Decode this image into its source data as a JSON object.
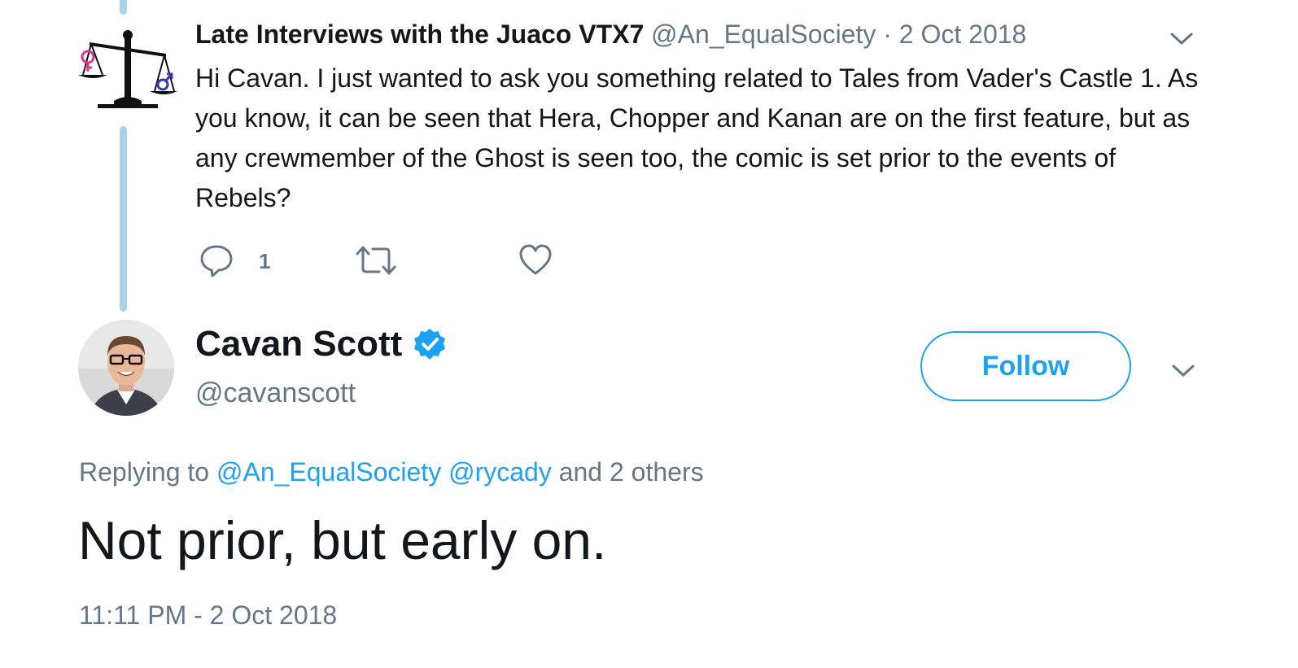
{
  "parent_tweet": {
    "display_name": "Late Interviews with the Juaco VTX7",
    "handle": "@An_EqualSociety",
    "separator": "·",
    "date": "2 Oct 2018",
    "text": "Hi Cavan. I just wanted to ask you something related to Tales from Vader's Castle 1. As you know, it can be seen that Hera, Chopper and Kanan are on the first feature, but as any crewmember of the Ghost is seen too, the comic is set prior to the events of Rebels?",
    "reply_count": "1"
  },
  "main_tweet": {
    "display_name": "Cavan Scott",
    "handle": "@cavanscott",
    "follow_label": "Follow",
    "replying_prefix": "Replying to",
    "mentions": [
      "@An_EqualSociety",
      "@rycady"
    ],
    "replying_suffix": "and 2 others",
    "text": "Not prior, but early on.",
    "timestamp": "11:11 PM - 2 Oct 2018"
  },
  "icons": {
    "reply": "speech-bubble-icon",
    "retweet": "retweet-icon",
    "like": "heart-icon",
    "verified": "verified-badge-icon",
    "menu": "chevron-down-icon"
  },
  "colors": {
    "accent": "#1da1f2",
    "muted": "#657786",
    "text": "#14171a",
    "thread_line": "#a7d2ee"
  }
}
